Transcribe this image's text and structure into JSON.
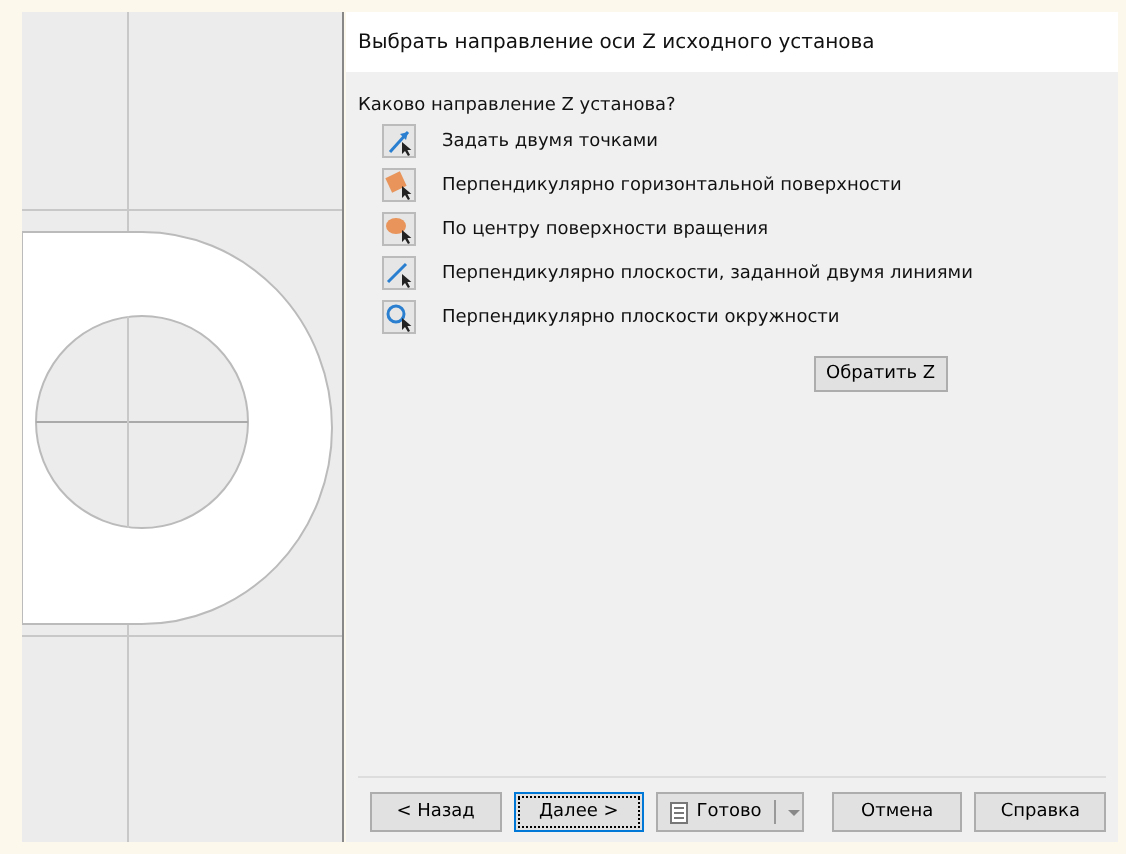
{
  "dialog": {
    "title": "Выбрать направление оси Z исходного установа",
    "question": "Каково направление Z установа?",
    "options": [
      {
        "kind": "two_points",
        "label": "Задать двумя точками"
      },
      {
        "kind": "horizontal",
        "label": "Перпендикулярно горизонтальной поверхности"
      },
      {
        "kind": "rotation",
        "label": "По центру поверхности вращения"
      },
      {
        "kind": "two_lines",
        "label": "Перпендикулярно плоскости, заданной двумя линиями"
      },
      {
        "kind": "circle",
        "label": "Перпендикулярно плоскости окружности"
      }
    ],
    "reverse_button": "Обратить Z",
    "buttons": [
      {
        "kind": "plain",
        "label": "< Назад",
        "focused": false
      },
      {
        "kind": "plain",
        "label": "Далее >",
        "focused": true
      },
      {
        "kind": "split",
        "label": "Готово",
        "focused": false
      },
      {
        "kind": "plain",
        "label": "Отмена",
        "focused": false
      },
      {
        "kind": "plain",
        "label": "Справка",
        "focused": false
      }
    ]
  }
}
